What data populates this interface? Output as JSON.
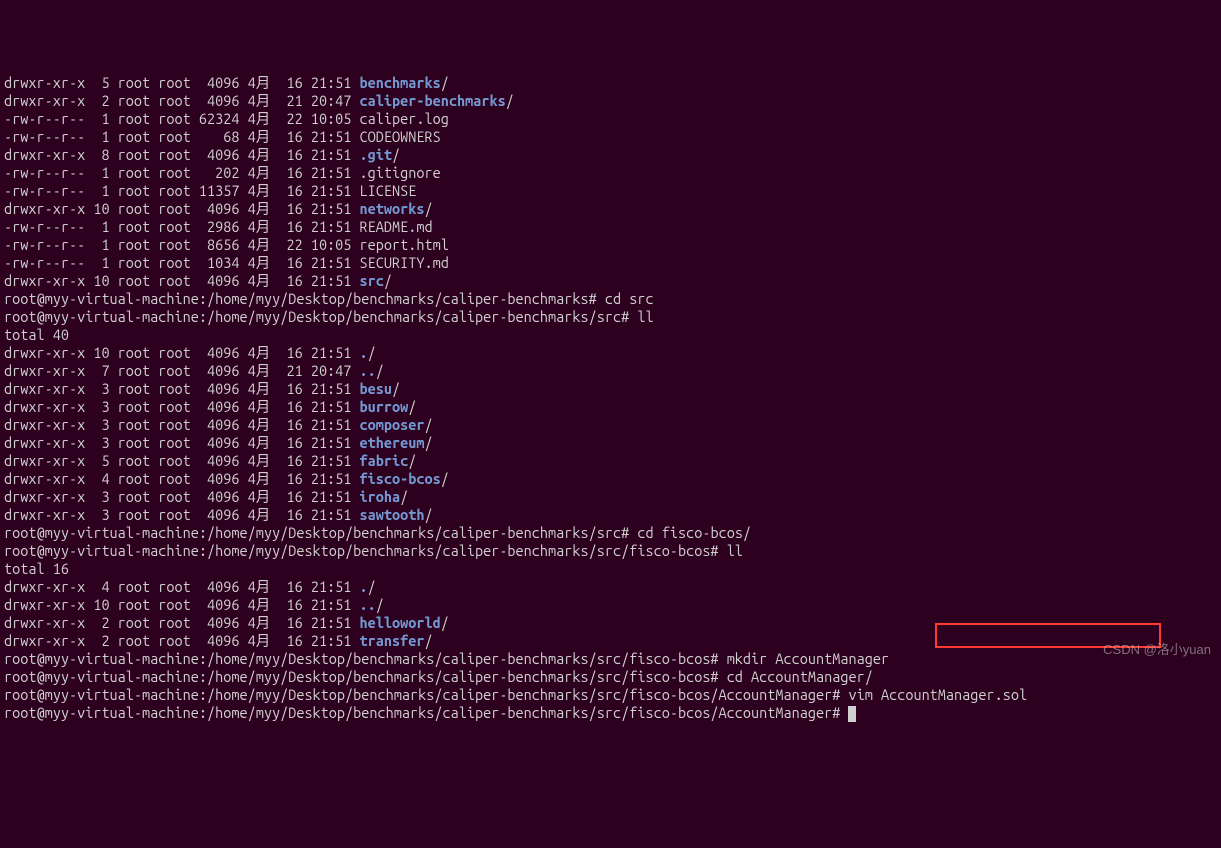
{
  "listing1": [
    {
      "perm": "drwxr-xr-x",
      "n": "5",
      "o": "root",
      "g": "root",
      "size": "4096",
      "mo": "4月",
      "d": "16",
      "t": "21:51",
      "name": "benchmarks",
      "type": "dir"
    },
    {
      "perm": "drwxr-xr-x",
      "n": "2",
      "o": "root",
      "g": "root",
      "size": "4096",
      "mo": "4月",
      "d": "21",
      "t": "20:47",
      "name": "caliper-benchmarks",
      "type": "dir"
    },
    {
      "perm": "-rw-r--r--",
      "n": "1",
      "o": "root",
      "g": "root",
      "size": "62324",
      "mo": "4月",
      "d": "22",
      "t": "10:05",
      "name": "caliper.log",
      "type": "file"
    },
    {
      "perm": "-rw-r--r--",
      "n": "1",
      "o": "root",
      "g": "root",
      "size": "68",
      "mo": "4月",
      "d": "16",
      "t": "21:51",
      "name": "CODEOWNERS",
      "type": "file"
    },
    {
      "perm": "drwxr-xr-x",
      "n": "8",
      "o": "root",
      "g": "root",
      "size": "4096",
      "mo": "4月",
      "d": "16",
      "t": "21:51",
      "name": ".git",
      "type": "dir"
    },
    {
      "perm": "-rw-r--r--",
      "n": "1",
      "o": "root",
      "g": "root",
      "size": "202",
      "mo": "4月",
      "d": "16",
      "t": "21:51",
      "name": ".gitignore",
      "type": "file"
    },
    {
      "perm": "-rw-r--r--",
      "n": "1",
      "o": "root",
      "g": "root",
      "size": "11357",
      "mo": "4月",
      "d": "16",
      "t": "21:51",
      "name": "LICENSE",
      "type": "file"
    },
    {
      "perm": "drwxr-xr-x",
      "n": "10",
      "o": "root",
      "g": "root",
      "size": "4096",
      "mo": "4月",
      "d": "16",
      "t": "21:51",
      "name": "networks",
      "type": "dir"
    },
    {
      "perm": "-rw-r--r--",
      "n": "1",
      "o": "root",
      "g": "root",
      "size": "2986",
      "mo": "4月",
      "d": "16",
      "t": "21:51",
      "name": "README.md",
      "type": "file"
    },
    {
      "perm": "-rw-r--r--",
      "n": "1",
      "o": "root",
      "g": "root",
      "size": "8656",
      "mo": "4月",
      "d": "22",
      "t": "10:05",
      "name": "report.html",
      "type": "file"
    },
    {
      "perm": "-rw-r--r--",
      "n": "1",
      "o": "root",
      "g": "root",
      "size": "1034",
      "mo": "4月",
      "d": "16",
      "t": "21:51",
      "name": "SECURITY.md",
      "type": "file"
    },
    {
      "perm": "drwxr-xr-x",
      "n": "10",
      "o": "root",
      "g": "root",
      "size": "4096",
      "mo": "4月",
      "d": "16",
      "t": "21:51",
      "name": "src",
      "type": "dir"
    }
  ],
  "prompt1": {
    "path": "root@myy-virtual-machine:/home/myy/Desktop/benchmarks/caliper-benchmarks#",
    "cmd": "cd src"
  },
  "prompt2": {
    "path": "root@myy-virtual-machine:/home/myy/Desktop/benchmarks/caliper-benchmarks/src#",
    "cmd": "ll"
  },
  "total2": "total 40",
  "listing2": [
    {
      "perm": "drwxr-xr-x",
      "n": "10",
      "o": "root",
      "g": "root",
      "size": "4096",
      "mo": "4月",
      "d": "16",
      "t": "21:51",
      "name": ".",
      "type": "dir"
    },
    {
      "perm": "drwxr-xr-x",
      "n": "7",
      "o": "root",
      "g": "root",
      "size": "4096",
      "mo": "4月",
      "d": "21",
      "t": "20:47",
      "name": "..",
      "type": "dir"
    },
    {
      "perm": "drwxr-xr-x",
      "n": "3",
      "o": "root",
      "g": "root",
      "size": "4096",
      "mo": "4月",
      "d": "16",
      "t": "21:51",
      "name": "besu",
      "type": "dir"
    },
    {
      "perm": "drwxr-xr-x",
      "n": "3",
      "o": "root",
      "g": "root",
      "size": "4096",
      "mo": "4月",
      "d": "16",
      "t": "21:51",
      "name": "burrow",
      "type": "dir"
    },
    {
      "perm": "drwxr-xr-x",
      "n": "3",
      "o": "root",
      "g": "root",
      "size": "4096",
      "mo": "4月",
      "d": "16",
      "t": "21:51",
      "name": "composer",
      "type": "dir"
    },
    {
      "perm": "drwxr-xr-x",
      "n": "3",
      "o": "root",
      "g": "root",
      "size": "4096",
      "mo": "4月",
      "d": "16",
      "t": "21:51",
      "name": "ethereum",
      "type": "dir"
    },
    {
      "perm": "drwxr-xr-x",
      "n": "5",
      "o": "root",
      "g": "root",
      "size": "4096",
      "mo": "4月",
      "d": "16",
      "t": "21:51",
      "name": "fabric",
      "type": "dir"
    },
    {
      "perm": "drwxr-xr-x",
      "n": "4",
      "o": "root",
      "g": "root",
      "size": "4096",
      "mo": "4月",
      "d": "16",
      "t": "21:51",
      "name": "fisco-bcos",
      "type": "dir"
    },
    {
      "perm": "drwxr-xr-x",
      "n": "3",
      "o": "root",
      "g": "root",
      "size": "4096",
      "mo": "4月",
      "d": "16",
      "t": "21:51",
      "name": "iroha",
      "type": "dir"
    },
    {
      "perm": "drwxr-xr-x",
      "n": "3",
      "o": "root",
      "g": "root",
      "size": "4096",
      "mo": "4月",
      "d": "16",
      "t": "21:51",
      "name": "sawtooth",
      "type": "dir"
    }
  ],
  "prompt3": {
    "path": "root@myy-virtual-machine:/home/myy/Desktop/benchmarks/caliper-benchmarks/src#",
    "cmd": "cd fisco-bcos/"
  },
  "prompt4": {
    "path": "root@myy-virtual-machine:/home/myy/Desktop/benchmarks/caliper-benchmarks/src/fisco-bcos#",
    "cmd": "ll"
  },
  "total3": "total 16",
  "listing3": [
    {
      "perm": "drwxr-xr-x",
      "n": "4",
      "o": "root",
      "g": "root",
      "size": "4096",
      "mo": "4月",
      "d": "16",
      "t": "21:51",
      "name": ".",
      "type": "dir"
    },
    {
      "perm": "drwxr-xr-x",
      "n": "10",
      "o": "root",
      "g": "root",
      "size": "4096",
      "mo": "4月",
      "d": "16",
      "t": "21:51",
      "name": "..",
      "type": "dir"
    },
    {
      "perm": "drwxr-xr-x",
      "n": "2",
      "o": "root",
      "g": "root",
      "size": "4096",
      "mo": "4月",
      "d": "16",
      "t": "21:51",
      "name": "helloworld",
      "type": "dir"
    },
    {
      "perm": "drwxr-xr-x",
      "n": "2",
      "o": "root",
      "g": "root",
      "size": "4096",
      "mo": "4月",
      "d": "16",
      "t": "21:51",
      "name": "transfer",
      "type": "dir"
    }
  ],
  "prompt5": {
    "path": "root@myy-virtual-machine:/home/myy/Desktop/benchmarks/caliper-benchmarks/src/fisco-bcos#",
    "cmd": "mkdir AccountManager"
  },
  "prompt6": {
    "path": "root@myy-virtual-machine:/home/myy/Desktop/benchmarks/caliper-benchmarks/src/fisco-bcos#",
    "cmd": "cd AccountManager/"
  },
  "prompt7": {
    "path": "root@myy-virtual-machine:/home/myy/Desktop/benchmarks/caliper-benchmarks/src/fisco-bcos/AccountManager#",
    "cmd": "vim AccountManager.sol"
  },
  "prompt8": {
    "path": "root@myy-virtual-machine:/home/myy/Desktop/benchmarks/caliper-benchmarks/src/fisco-bcos/AccountManager#",
    "cmd": ""
  },
  "watermark": "CSDN @洛小yuan"
}
